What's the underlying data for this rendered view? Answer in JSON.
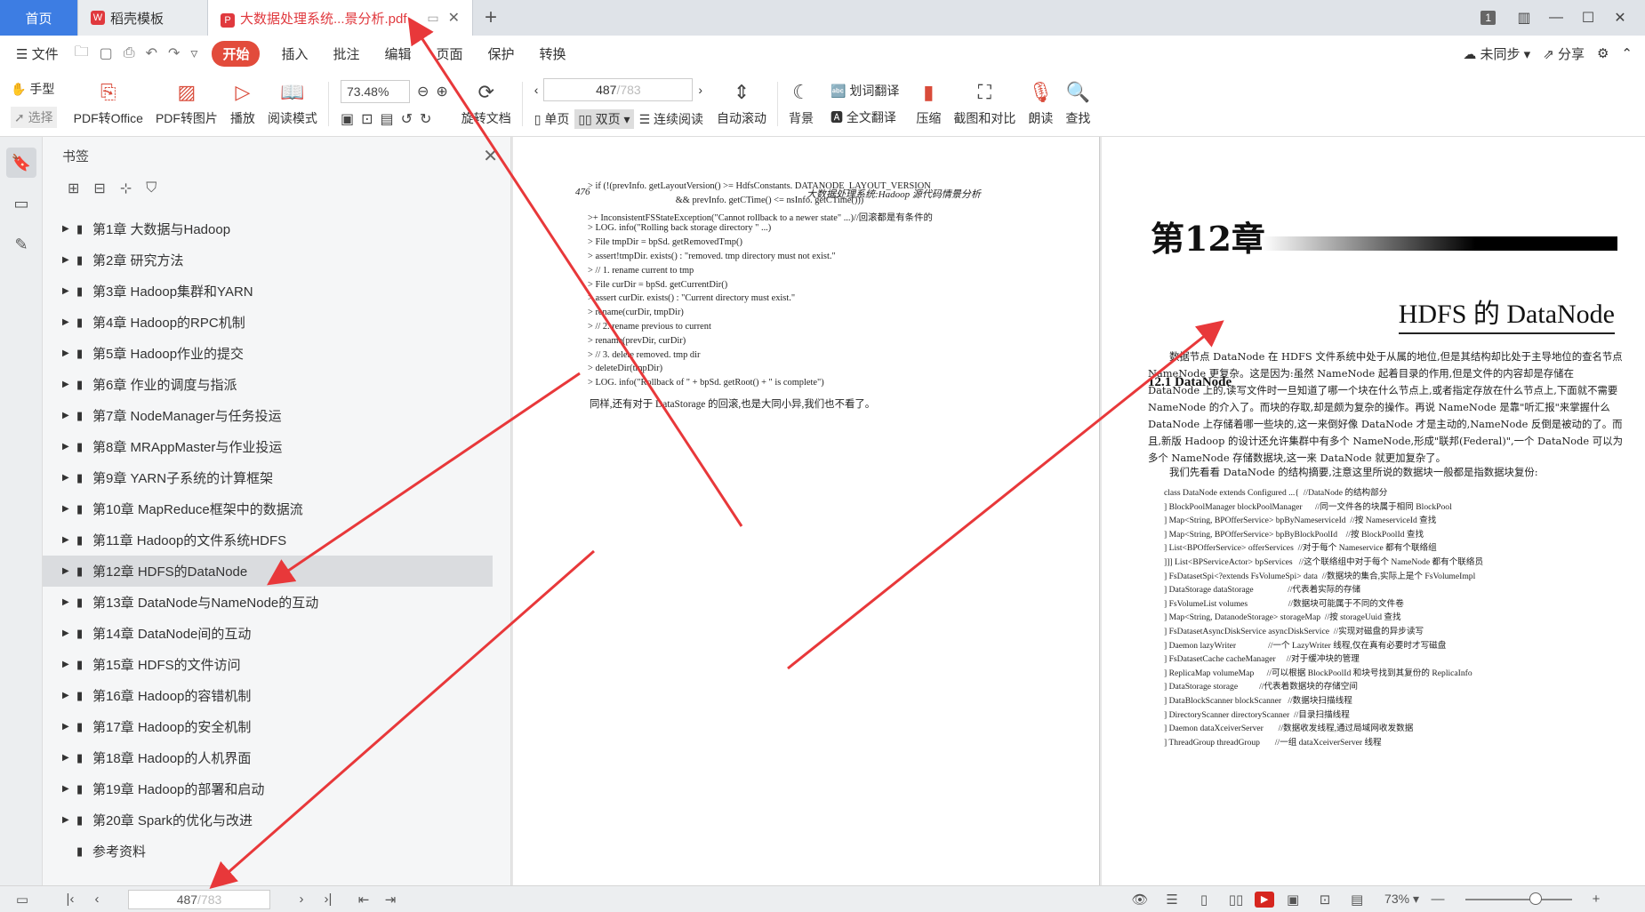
{
  "tabs": {
    "home": "首页",
    "template": "稻壳模板",
    "doc": "大数据处理系统...景分析.pdf",
    "count": "1"
  },
  "menu": {
    "file": "文件",
    "items": [
      "开始",
      "插入",
      "批注",
      "编辑",
      "页面",
      "保护",
      "转换"
    ],
    "sync": "未同步",
    "share": "分享"
  },
  "toolbar": {
    "hand": "手型",
    "select": "选择",
    "pdf_to_office": "PDF转Office",
    "pdf_to_image": "PDF转图片",
    "play": "播放",
    "read_mode": "阅读模式",
    "zoom": "73.48%",
    "rotate": "旋转文档",
    "page_current": "487",
    "page_total": "/783",
    "single": "单页",
    "double": "双页",
    "continuous": "连续阅读",
    "autoscroll": "自动滚动",
    "background": "背景",
    "word_translate": "划词翻译",
    "full_translate": "全文翻译",
    "compress": "压缩",
    "screenshot": "截图和对比",
    "read_aloud": "朗读",
    "find": "查找"
  },
  "bookmarks": {
    "title": "书签",
    "items": [
      "第1章  大数据与Hadoop",
      "第2章  研究方法",
      "第3章  Hadoop集群和YARN",
      "第4章  Hadoop的RPC机制",
      "第5章  Hadoop作业的提交",
      "第6章  作业的调度与指派",
      "第7章  NodeManager与任务投运",
      "第8章  MRAppMaster与作业投运",
      "第9章  YARN子系统的计算框架",
      "第10章  MapReduce框架中的数据流",
      "第11章  Hadoop的文件系统HDFS",
      "第12章  HDFS的DataNode",
      "第13章  DataNode与NameNode的互动",
      "第14章  DataNode间的互动",
      "第15章  HDFS的文件访问",
      "第16章  Hadoop的容错机制",
      "第17章  Hadoop的安全机制",
      "第18章  Hadoop的人机界面",
      "第19章  Hadoop的部署和启动",
      "第20章  Spark的优化与改进",
      "参考资料"
    ]
  },
  "left_page": {
    "number": "476",
    "header": "大数据处理系统:Hadoop 源代码情景分析",
    "code": [
      "> if (!(prevInfo. getLayoutVersion() >= HdfsConstants. DATANODE_LAYOUT_VERSION",
      "                                      && prevInfo. getCTime() <= nsInfo. getCTime()))",
      ">+ InconsistentFSStateException(\"Cannot rollback to a newer state\" ...)//回滚都是有条件的",
      "> LOG. info(\"Rolling back storage directory \" ...)",
      "> File tmpDir = bpSd. getRemovedTmp()",
      "> assert!tmpDir. exists() : \"removed. tmp directory must not exist.\"",
      "> // 1. rename current to tmp",
      "> File curDir = bpSd. getCurrentDir()",
      "> assert curDir. exists() : \"Current directory must exist.\"",
      "> rename(curDir, tmpDir)",
      "> // 2. rename previous to current",
      "> rename(prevDir, curDir)",
      "> // 3. delete removed. tmp dir",
      "> deleteDir(tmpDir)",
      "> LOG. info(\"Rollback of \" + bpSd. getRoot() + \" is complete\")"
    ],
    "footer": "同样,还有对于 DataStorage 的回滚,也是大同小异,我们也不看了。"
  },
  "right_page": {
    "chapter": "第12章",
    "title": "HDFS 的 DataNode",
    "section": "12.1   DataNode",
    "para1": "数据节点 DataNode 在 HDFS 文件系统中处于从属的地位,但是其结构却比处于主导地位的查名节点 NameNode 更复杂。这是因为:虽然 NameNode 起着目录的作用,但是文件的内容却是存储在 DataNode 上的,读写文件时一旦知道了哪一个块在什么节点上,或者指定存放在什么节点上,下面就不需要 NameNode 的介入了。而块的存取,却是颇为复杂的操作。再说 NameNode 是靠\"听汇报\"来掌握什么 DataNode 上存储着哪一些块的,这一来倒好像 DataNode 才是主动的,NameNode 反倒是被动的了。而且,新版 Hadoop 的设计还允许集群中有多个 NameNode,形成\"联邦(Federal)\",一个 DataNode 可以为多个 NameNode 存储数据块,这一来 DataNode 就更加复杂了。",
    "para2": "我们先看看 DataNode 的结构摘要,注意这里所说的数据块一般都是指数据块复份:",
    "code": [
      "class DataNode extends Configured ...{  //DataNode 的结构部分",
      "] BlockPoolManager blockPoolManager      //同一文件各的块属于相同 BlockPool",
      "] Map<String, BPOfferService> bpByNameserviceId  //按 NameserviceId 查找",
      "] Map<String, BPOfferService> bpByBlockPoolId    //按 BlockPoolId 查找",
      "] List<BPOfferService> offerServices  //对于每个 Nameservice 都有个联络组",
      "]]] List<BPServiceActor> bpServices   //这个联络组中对于每个 NameNode 都有个联络员",
      "] FsDatasetSpi<?extends FsVolumeSpi> data  //数据块的集合,实际上是个 FsVolumeImpl",
      "] DataStorage dataStorage                //代表着实际的存储",
      "] FsVolumeList volumes                   //数据块可能属于不同的文件卷",
      "] Map<String, DatanodeStorage> storageMap  //按 storageUuid 查找",
      "] FsDatasetAsyncDiskService asyncDiskService  //实现对磁盘的异步读写",
      "] Daemon lazyWriter               //一个 LazyWriter 线程,仅在真有必要时才写磁盘",
      "] FsDatasetCache cacheManager     //对于缓冲块的管理",
      "] ReplicaMap volumeMap      //可以根据 BlockPoolId 和块号找到其复份的 ReplicaInfo",
      "] DataStorage storage          //代表着数据块的存储空间",
      "] DataBlockScanner blockScanner   //数据块扫描线程",
      "] DirectoryScanner directoryScanner  //目录扫描线程",
      "] Daemon dataXceiverServer       //数据收发线程,通过局域网收发数据",
      "] ThreadGroup threadGroup       //一组 dataXceiverServer 线程"
    ]
  },
  "statusbar": {
    "page_current": "487",
    "page_total": "/783",
    "zoom": "73%"
  },
  "colors": {
    "accent_red": "#e24b3b",
    "home_tab_blue": "#3d7de3",
    "annotation_arrow": "#e8383a"
  }
}
